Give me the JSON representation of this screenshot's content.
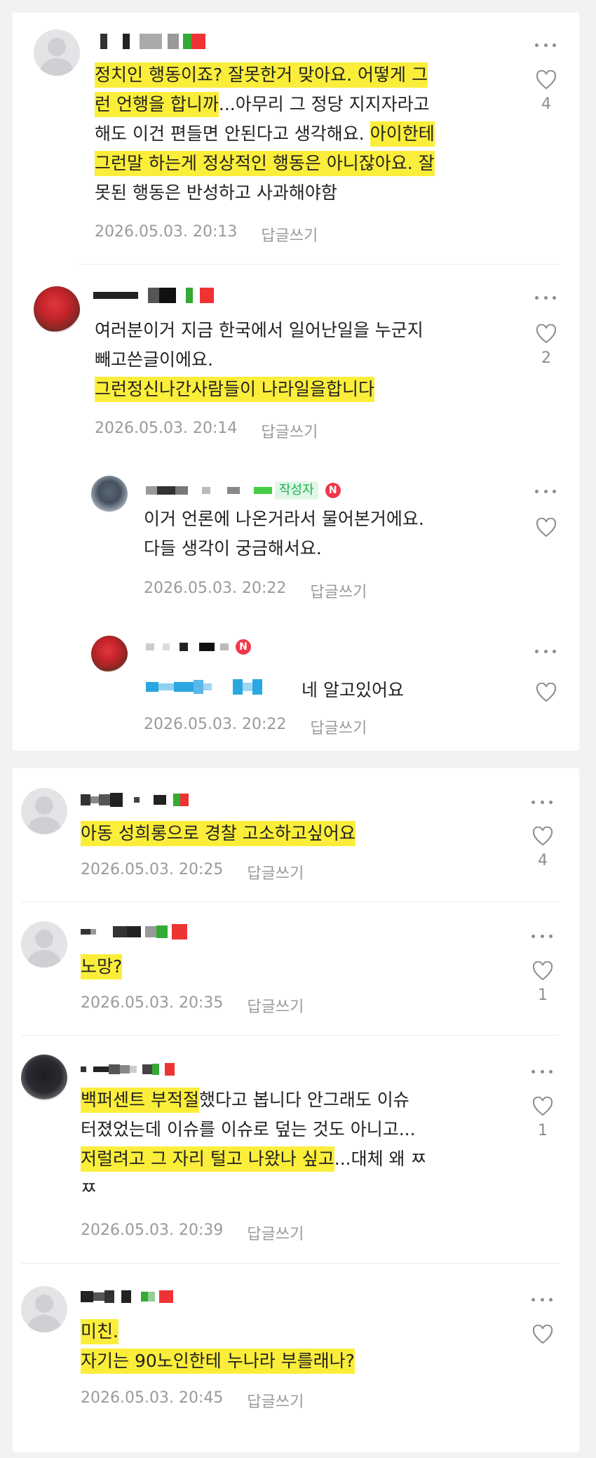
{
  "ui": {
    "reply_label": "답글쓰기",
    "author_badge": "작성자",
    "naver_badge": "N",
    "colors": {
      "highlight": "#fbee3a",
      "meta_text": "#9a9a9a",
      "author_green": "#18b349",
      "n_red": "#f0384a"
    }
  },
  "comments": [
    {
      "lines": [
        "정치인 행동이죠? 잘못한거 맞아요. 어떻게 그",
        "런 언행을 합니까...아무리 그 정당 지지자라고",
        "해도 이건 편들면 안된다고 생각해요. 아이한테",
        "그런말 하는게 정상적인 행동은 아니잖아요. 잘",
        "못된 행동은 반성하고 사과해야함"
      ],
      "date": "2026.05.03. 20:13",
      "likes": "4"
    },
    {
      "lines": [
        "여러분이거 지금 한국에서 일어난일을 누군지",
        "빼고쓴글이에요.",
        "그런정신나간사람들이 나라일을합니다"
      ],
      "date": "2026.05.03. 20:14",
      "likes": "2"
    },
    {
      "lines": [
        "이거 언론에 나온거라서 물어본거에요.",
        "다들 생각이 궁금해서요."
      ],
      "date": "2026.05.03. 20:22",
      "likes": ""
    },
    {
      "lines": [
        "네 알고있어요"
      ],
      "date": "2026.05.03. 20:22",
      "likes": ""
    },
    {
      "lines": [
        "아동 성희롱으로 경찰 고소하고싶어요"
      ],
      "date": "2026.05.03. 20:25",
      "likes": "4"
    },
    {
      "lines": [
        "노망?"
      ],
      "date": "2026.05.03. 20:35",
      "likes": "1"
    },
    {
      "lines": [
        "백퍼센트 부적절했다고 봅니다 안그래도 이슈",
        "터졌었는데 이슈를 이슈로 덮는 것도 아니고...",
        "저럴려고 그 자리 털고 나왔나 싶고...대체 왜 ㅉ",
        "ㅉ"
      ],
      "date": "2026.05.03. 20:39",
      "likes": "1"
    },
    {
      "lines": [
        "미친.",
        "자기는 90노인한테 누나라 부를래나?"
      ],
      "date": "2026.05.03. 20:45",
      "likes": ""
    }
  ]
}
